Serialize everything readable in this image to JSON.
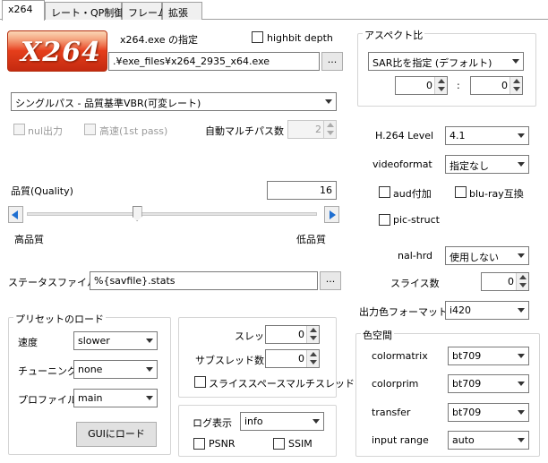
{
  "tabs": [
    {
      "label": "x264"
    },
    {
      "label": "レート・QP制御"
    },
    {
      "label": "フレーム"
    },
    {
      "label": "拡張"
    }
  ],
  "logo": {
    "text": "X264"
  },
  "exe": {
    "label": "x264.exe の指定",
    "highbit_label": "highbit depth",
    "path": ".¥exe_files¥x264_2935_x64.exe",
    "browse": "..."
  },
  "mode": {
    "selected": "シングルパス - 品質基準VBR(可変レート)"
  },
  "pass": {
    "nul_label": "nul出力",
    "fast_label": "高速(1st pass)",
    "auto_multipass_label": "自動マルチパス数",
    "auto_multipass_value": "2"
  },
  "quality": {
    "label": "品質(Quality)",
    "value": "16",
    "slider_fraction": 0.38,
    "high_label": "高品質",
    "low_label": "低品質"
  },
  "stats": {
    "label": "ステータスファイル",
    "value": "%{savfile}.stats",
    "browse": "..."
  },
  "preset": {
    "title": "プリセットのロード",
    "speed_label": "速度",
    "speed_value": "slower",
    "tune_label": "チューニング",
    "tune_value": "none",
    "profile_label": "プロファイル",
    "profile_value": "main",
    "load_button": "GUIにロード"
  },
  "threads": {
    "thread_label": "スレッド数",
    "thread_value": "0",
    "subthread_label": "サブスレッド数",
    "subthread_value": "0",
    "slice_multi_label": "スライススペースマルチスレッド"
  },
  "log": {
    "label": "ログ表示",
    "value": "info",
    "psnr_label": "PSNR",
    "ssim_label": "SSIM"
  },
  "aspect": {
    "title": "アスペクト比",
    "mode": "SAR比を指定 (デフォルト)",
    "x": "0",
    "sep": ":",
    "y": "0"
  },
  "h264": {
    "level_label": "H.264 Level",
    "level_value": "4.1",
    "videoformat_label": "videoformat",
    "videoformat_value": "指定なし",
    "aud_label": "aud付加",
    "bluray_label": "blu-ray互換",
    "picstruct_label": "pic-struct",
    "nalhrd_label": "nal-hrd",
    "nalhrd_value": "使用しない",
    "slices_label": "スライス数",
    "slices_value": "0",
    "outcsp_label": "出力色フォーマット",
    "outcsp_value": "i420"
  },
  "colorspace": {
    "title": "色空間",
    "matrix_label": "colormatrix",
    "matrix_value": "bt709",
    "prim_label": "colorprim",
    "prim_value": "bt709",
    "transfer_label": "transfer",
    "transfer_value": "bt709",
    "range_label": "input range",
    "range_value": "auto"
  },
  "colors": {
    "logo_bg": "#e8401c",
    "logo_text": "#ffffff",
    "accent": "#1f6fd1"
  }
}
